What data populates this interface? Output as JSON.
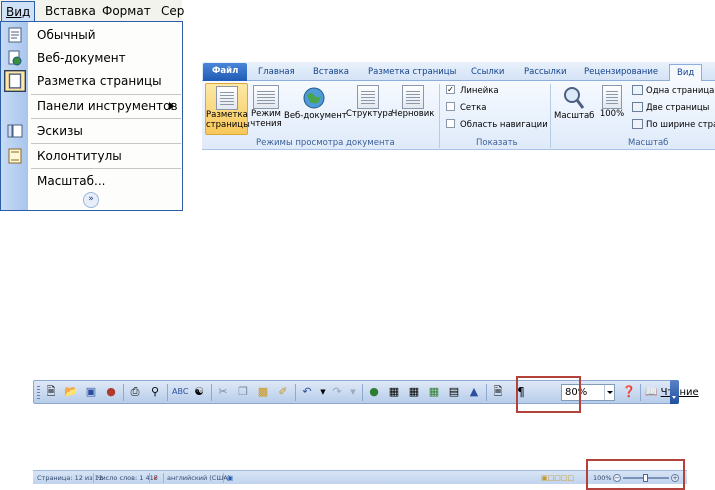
{
  "menubar": {
    "items": [
      "Вид",
      "Вставка",
      "Формат",
      "Сер"
    ]
  },
  "view_menu": {
    "items": [
      {
        "label": "Обычный",
        "icon": "normal-view-icon"
      },
      {
        "label": "Веб-документ",
        "icon": "web-document-icon"
      },
      {
        "label": "Разметка страницы",
        "icon": "page-layout-icon",
        "selected": true
      },
      {
        "label": "Панели инструментов",
        "submenu": true
      },
      {
        "label": "Эскизы",
        "icon": "thumbnails-icon"
      },
      {
        "label": "Колонтитулы",
        "icon": "header-footer-icon"
      },
      {
        "label": "Масштаб...",
        "icon": ""
      }
    ],
    "more_icon": "double-chevron-down-icon"
  },
  "ribbon": {
    "tabs": [
      "Файл",
      "Главная",
      "Вставка",
      "Разметка страницы",
      "Ссылки",
      "Рассылки",
      "Рецензирование",
      "Вид"
    ],
    "active_tab": "Вид",
    "views_group": {
      "label": "Режимы просмотра документа",
      "buttons": [
        {
          "label_line1": "Разметка",
          "label_line2": "страницы"
        },
        {
          "label_line1": "Режим",
          "label_line2": "чтения"
        },
        {
          "label_line1": "Веб-документ",
          "label_line2": ""
        },
        {
          "label_line1": "Структура",
          "label_line2": ""
        },
        {
          "label_line1": "Черновик",
          "label_line2": ""
        }
      ]
    },
    "show_group": {
      "label": "Показать",
      "checkboxes": [
        {
          "label": "Линейка",
          "checked": true
        },
        {
          "label": "Сетка",
          "checked": false
        },
        {
          "label": "Область навигации",
          "checked": false
        }
      ]
    },
    "zoom_group": {
      "label": "Масштаб",
      "zoom_button": "Масштаб",
      "hundred_button": "100%",
      "small_buttons": [
        "Одна страница",
        "Две страницы",
        "По ширине стра"
      ]
    }
  },
  "toolbar": {
    "zoom_value": "80%",
    "read_button": "Чтение",
    "icons": [
      "new-document-icon",
      "open-folder-icon",
      "save-icon",
      "permission-icon",
      "print-icon",
      "print-preview-icon",
      "spelling-icon",
      "research-icon",
      "cut-icon",
      "copy-icon",
      "paste-icon",
      "format-painter-icon",
      "undo-icon",
      "redo-icon",
      "hyperlink-icon",
      "tables-borders-icon",
      "insert-table-icon",
      "insert-excel-icon",
      "columns-icon",
      "drawing-icon",
      "document-map-icon",
      "show-hide-icon",
      "help-icon"
    ]
  },
  "statusbar": {
    "page": "Страница: 12 из 12",
    "words": "Число слов: 1 415",
    "language": "английский (США)",
    "zoom": "100%"
  },
  "colors": {
    "highlight": "#b3423c",
    "ribbon_accent": "#1f5bb5"
  }
}
